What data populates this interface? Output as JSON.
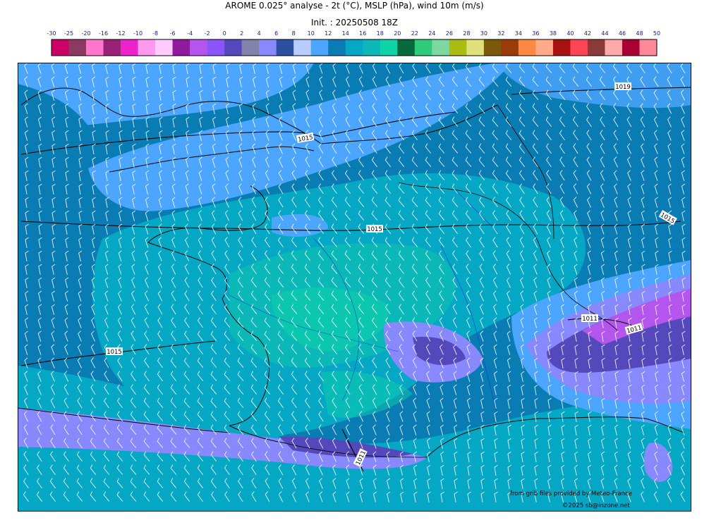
{
  "title": "AROME 0.025° analyse - 2t (°C), MSLP (hPa), wind 10m (m/s)",
  "subtitle": "Init. : 20250508 18Z",
  "legend": {
    "ticks": [
      "-30",
      "-25",
      "-20",
      "-16",
      "-12",
      "-10",
      "-8",
      "-6",
      "-4",
      "-2",
      "0",
      "2",
      "4",
      "6",
      "8",
      "10",
      "12",
      "14",
      "16",
      "18",
      "20",
      "22",
      "24",
      "26",
      "28",
      "30",
      "32",
      "34",
      "36",
      "38",
      "40",
      "42",
      "44",
      "46",
      "48",
      "50"
    ],
    "colors": [
      "#cc0066",
      "#8b3a62",
      "#ff77cc",
      "#992277",
      "#ee22cc",
      "#ff99ee",
      "#ffccff",
      "#8e1a9e",
      "#b455ee",
      "#8a55ff",
      "#5548bb",
      "#8282aa",
      "#8888ff",
      "#2d4fa0",
      "#b8ccff",
      "#4ca6ff",
      "#0a7cb4",
      "#05a8c4",
      "#0ab8b8",
      "#0fd4a8",
      "#066a3c",
      "#2ecc7a",
      "#7ad8a0",
      "#aabb11",
      "#e0e07a",
      "#7a5a0a",
      "#9a3c0a",
      "#ff8844",
      "#ffaa88",
      "#aa1111",
      "#ff4455",
      "#8b3a3a",
      "#ffaaaa",
      "#aa0033",
      "#ff8899"
    ]
  },
  "isobars": [
    "1019",
    "1015",
    "1015",
    "1015",
    "1015",
    "1011",
    "1011",
    "1011"
  ],
  "credits": {
    "line1": "from grib files provided by Meteo-France",
    "line2": "©2025 sb@inzone.net"
  }
}
